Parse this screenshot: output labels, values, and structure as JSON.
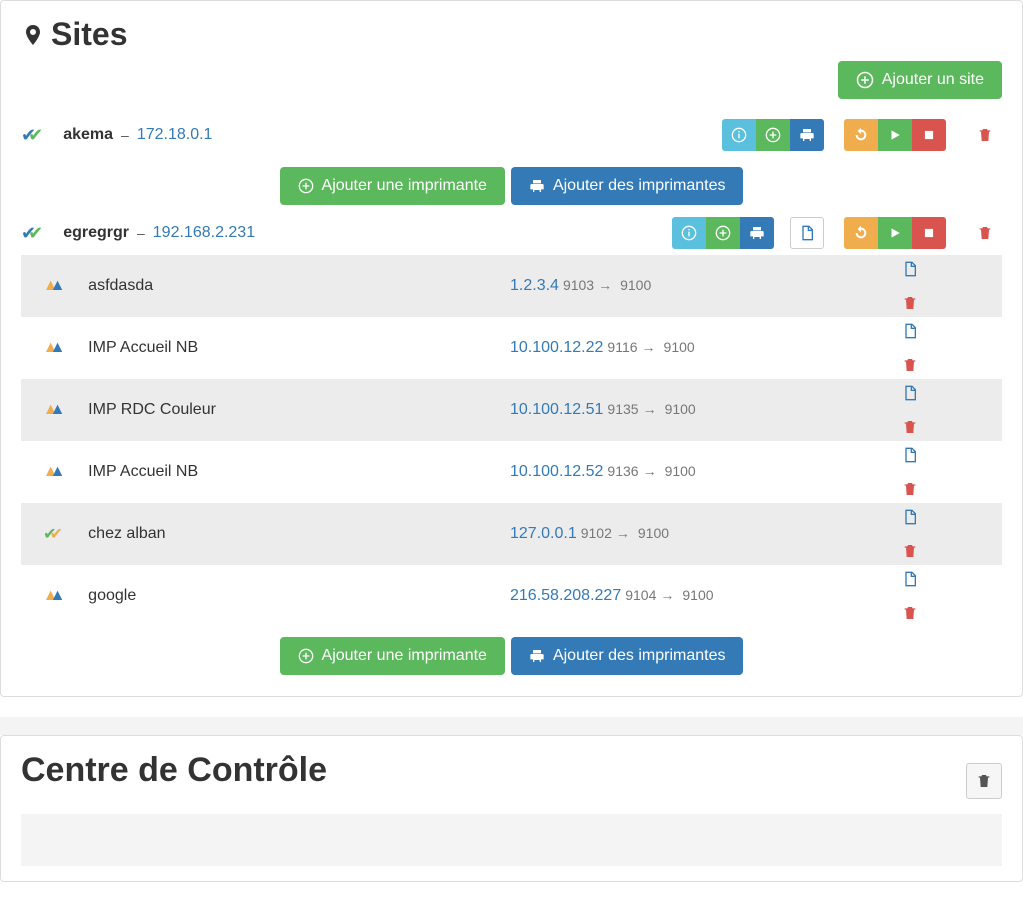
{
  "sites_title": "Sites",
  "add_site_label": "Ajouter un site",
  "add_printer_label": "Ajouter une imprimante",
  "add_printers_label": "Ajouter des imprimantes",
  "control_center_title": "Centre de Contrôle",
  "sites": [
    {
      "name": "akema",
      "ip": "172.18.0.1",
      "has_file_btn": false,
      "printers": []
    },
    {
      "name": "egregrgr",
      "ip": "192.168.2.231",
      "has_file_btn": true,
      "printers": [
        {
          "status": "warn",
          "name": "asfdasda",
          "ip": "1.2.3.4",
          "port_from": "9103",
          "port_to": "9100"
        },
        {
          "status": "warn",
          "name": "IMP Accueil NB",
          "ip": "10.100.12.22",
          "port_from": "9116",
          "port_to": "9100"
        },
        {
          "status": "warn",
          "name": "IMP RDC Couleur",
          "ip": "10.100.12.51",
          "port_from": "9135",
          "port_to": "9100"
        },
        {
          "status": "warn",
          "name": "IMP Accueil NB",
          "ip": "10.100.12.52",
          "port_from": "9136",
          "port_to": "9100"
        },
        {
          "status": "ok",
          "name": "chez alban",
          "ip": "127.0.0.1",
          "port_from": "9102",
          "port_to": "9100"
        },
        {
          "status": "warn",
          "name": "google",
          "ip": "216.58.208.227",
          "port_from": "9104",
          "port_to": "9100"
        }
      ]
    }
  ]
}
